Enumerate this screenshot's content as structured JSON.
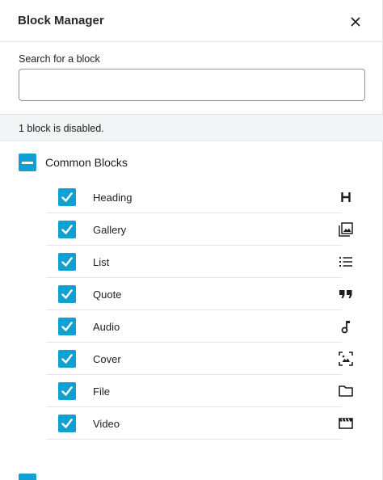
{
  "header": {
    "title": "Block Manager",
    "close_icon": "close-icon"
  },
  "search": {
    "label": "Search for a block",
    "value": "",
    "placeholder": ""
  },
  "status": {
    "disabled_text": "1 block is disabled."
  },
  "category": {
    "label": "Common Blocks"
  },
  "blocks": [
    {
      "label": "Heading",
      "icon": "heading-icon",
      "checked": true
    },
    {
      "label": "Gallery",
      "icon": "gallery-icon",
      "checked": true
    },
    {
      "label": "List",
      "icon": "list-icon",
      "checked": true
    },
    {
      "label": "Quote",
      "icon": "quote-icon",
      "checked": true
    },
    {
      "label": "Audio",
      "icon": "audio-icon",
      "checked": true
    },
    {
      "label": "Cover",
      "icon": "cover-icon",
      "checked": true
    },
    {
      "label": "File",
      "icon": "file-icon",
      "checked": true
    },
    {
      "label": "Video",
      "icon": "video-icon",
      "checked": true
    }
  ],
  "colors": {
    "accent": "#11a0d2",
    "divider": "#e2e4e7",
    "status_bg": "#f3f4f5"
  }
}
